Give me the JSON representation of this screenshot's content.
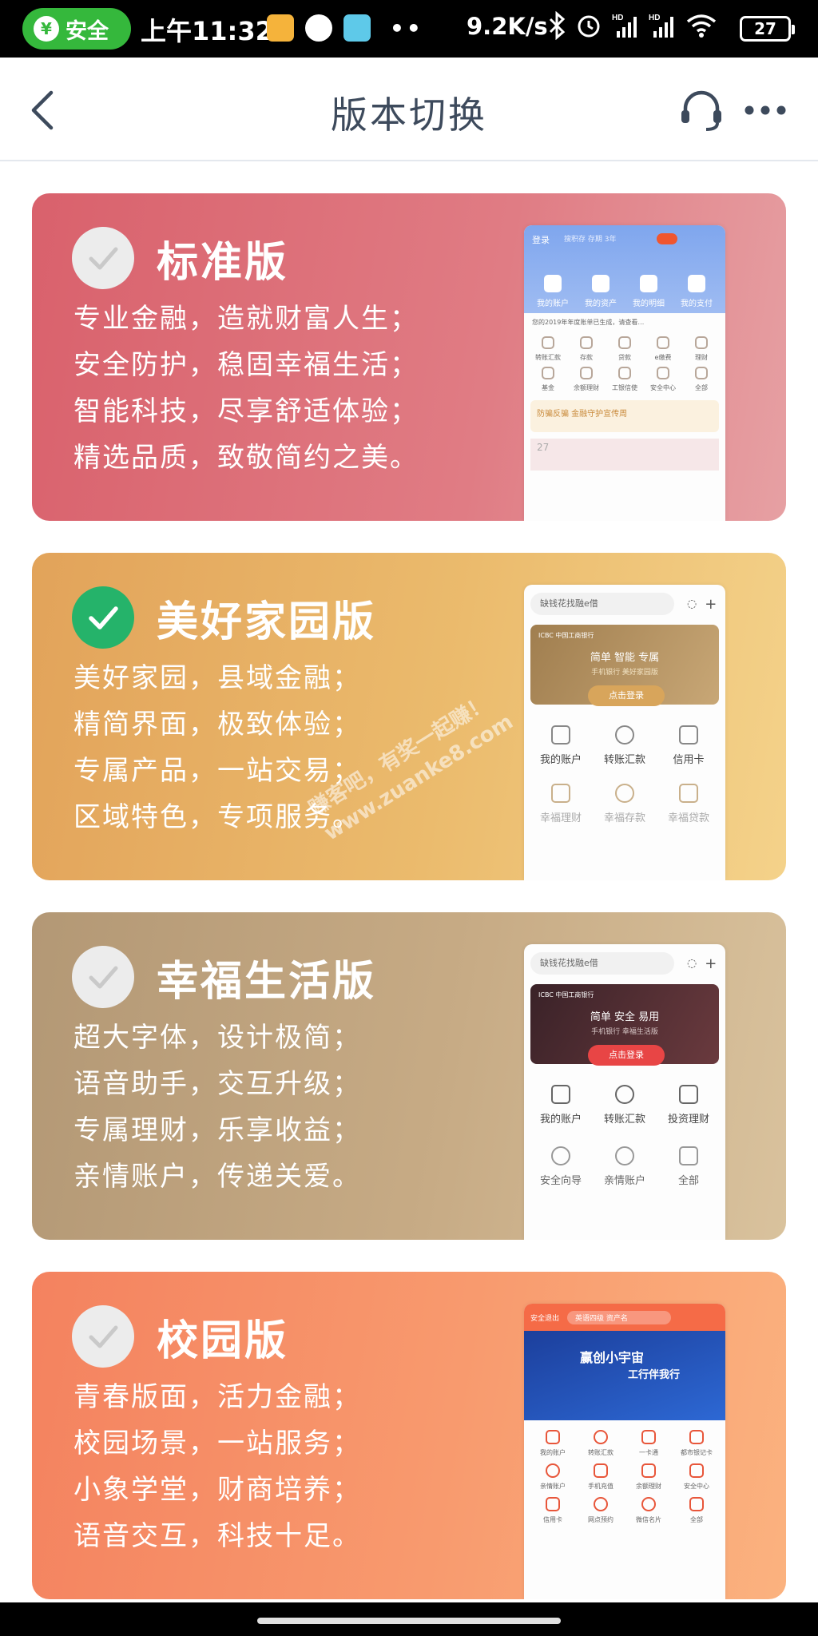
{
  "status_bar": {
    "safe_label": "安全",
    "safe_icon": "yuan-shield-icon",
    "time": "上午11:32",
    "more_dots": "••",
    "net_speed": "9.2K/s",
    "hd1": "HD",
    "hd2": "HD",
    "battery": "27"
  },
  "nav": {
    "title": "版本切换"
  },
  "cards": [
    {
      "title": "标准版",
      "selected": false,
      "lines": [
        "专业金融，造就财富人生；",
        "安全防护，稳固幸福生活；",
        "智能科技，尽享舒适体验；",
        "精选品质，致敬简约之美。"
      ],
      "preview": {
        "login": "登录",
        "search": "搜积存 存期 3年",
        "tabs": [
          "我的账户",
          "我的资产",
          "我的明细",
          "我的支付"
        ],
        "notice": "您的2019年年度账单已生成，请查看…",
        "grid": [
          "转账汇款",
          "存款",
          "贷款",
          "e缴费",
          "理财",
          "基金",
          "余额理财",
          "工银信使",
          "安全中心",
          "全部"
        ],
        "banner": "防骗反骗 金融守护宣传周",
        "date": "27"
      }
    },
    {
      "title": "美好家园版",
      "selected": true,
      "lines": [
        "美好家园，县域金融；",
        "精简界面，极致体验；",
        "专属产品，一站交易；",
        "区域特色，专项服务。"
      ],
      "preview": {
        "search": "缺钱花找融e借",
        "brand": "ICBC 中国工商银行",
        "banner_title": "简单 智能 专属",
        "banner_sub": "手机银行 美好家园版",
        "login_btn": "点击登录",
        "row1": [
          "我的账户",
          "转账汇款",
          "信用卡"
        ],
        "row2": [
          "幸福理财",
          "幸福存款",
          "幸福贷款"
        ]
      }
    },
    {
      "title": "幸福生活版",
      "selected": false,
      "lines": [
        "超大字体，设计极简；",
        "语音助手，交互升级；",
        "专属理财，乐享收益；",
        "亲情账户，传递关爱。"
      ],
      "preview": {
        "search": "缺钱花找融e借",
        "brand": "ICBC 中国工商银行",
        "banner_title": "简单 安全 易用",
        "banner_sub": "手机银行 幸福生活版",
        "login_btn": "点击登录",
        "row1": [
          "我的账户",
          "转账汇款",
          "投资理财"
        ],
        "row2": [
          "安全向导",
          "亲情账户",
          "全部"
        ]
      }
    },
    {
      "title": "校园版",
      "selected": false,
      "lines": [
        "青春版面，活力金融；",
        "校园场景，一站服务；",
        "小象学堂，财商培养；",
        "语音交互，科技十足。"
      ],
      "preview": {
        "top_label": "安全退出",
        "search": "英语四级 资产名",
        "banner_title": "赢创小宇宙",
        "banner_sub": "工行伴我行",
        "row1": [
          "我的账户",
          "转账汇款",
          "一卡通",
          "都市银记卡"
        ],
        "row2": [
          "亲情账户",
          "手机充值",
          "余额理财",
          "安全中心"
        ],
        "row3": [
          "信用卡",
          "网点预约",
          "微信名片",
          "全部"
        ]
      }
    }
  ],
  "watermark": {
    "line1": "赚客吧，有奖一起赚！",
    "line2": "www.zuanke8.com"
  },
  "colors": {
    "standard": "#d9616c",
    "home": "#e2a35a",
    "happy": "#b39875",
    "campus": "#f4825f",
    "check_on": "#25b36a",
    "title": "#3d4a5c"
  }
}
